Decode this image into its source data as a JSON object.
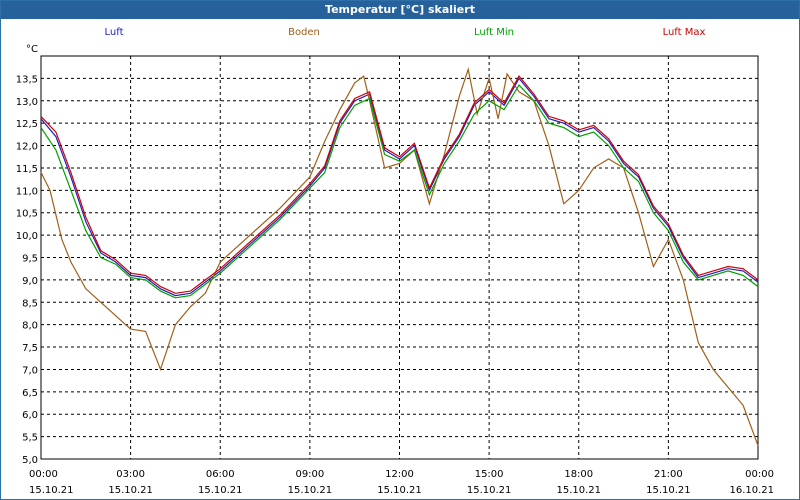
{
  "chart_data": {
    "type": "line",
    "title": "Temperatur [°C] skaliert",
    "ylabel": "°C",
    "xlabel": "",
    "ylim": [
      5.0,
      14.0
    ],
    "xlim": [
      0,
      24
    ],
    "y_ticks": [
      "5,0",
      "5,5",
      "6,0",
      "6,5",
      "7,0",
      "7,5",
      "8,0",
      "8,5",
      "9,0",
      "9,5",
      "10,0",
      "10,5",
      "11,0",
      "11,5",
      "12,0",
      "12,5",
      "13,0",
      "13,5"
    ],
    "x_ticks": [
      {
        "time": "00:00",
        "date": "15.10.21"
      },
      {
        "time": "03:00",
        "date": "15.10.21"
      },
      {
        "time": "06:00",
        "date": "15.10.21"
      },
      {
        "time": "09:00",
        "date": "15.10.21"
      },
      {
        "time": "12:00",
        "date": "15.10.21"
      },
      {
        "time": "15:00",
        "date": "15.10.21"
      },
      {
        "time": "18:00",
        "date": "15.10.21"
      },
      {
        "time": "21:00",
        "date": "15.10.21"
      },
      {
        "time": "00:00",
        "date": "16.10.21"
      }
    ],
    "grid": true,
    "legend_position": "top",
    "series": [
      {
        "name": "Luft",
        "color": "#2020c0",
        "points": [
          [
            0,
            12.6
          ],
          [
            0.5,
            12.2
          ],
          [
            1,
            11.3
          ],
          [
            1.5,
            10.3
          ],
          [
            2,
            9.6
          ],
          [
            2.5,
            9.4
          ],
          [
            3,
            9.1
          ],
          [
            3.5,
            9.05
          ],
          [
            4,
            8.8
          ],
          [
            4.5,
            8.65
          ],
          [
            5,
            8.7
          ],
          [
            5.5,
            8.95
          ],
          [
            6,
            9.2
          ],
          [
            7,
            9.8
          ],
          [
            8,
            10.4
          ],
          [
            9,
            11.1
          ],
          [
            9.5,
            11.5
          ],
          [
            10,
            12.5
          ],
          [
            10.5,
            13.0
          ],
          [
            11,
            13.15
          ],
          [
            11.5,
            11.9
          ],
          [
            12,
            11.7
          ],
          [
            12.5,
            12.0
          ],
          [
            13,
            11.0
          ],
          [
            13.5,
            11.7
          ],
          [
            14,
            12.2
          ],
          [
            14.5,
            12.9
          ],
          [
            15,
            13.2
          ],
          [
            15.5,
            12.9
          ],
          [
            16,
            13.5
          ],
          [
            16.5,
            13.1
          ],
          [
            17,
            12.6
          ],
          [
            17.5,
            12.5
          ],
          [
            18,
            12.3
          ],
          [
            18.5,
            12.4
          ],
          [
            19,
            12.1
          ],
          [
            19.5,
            11.6
          ],
          [
            20,
            11.3
          ],
          [
            20.5,
            10.6
          ],
          [
            21,
            10.2
          ],
          [
            21.5,
            9.5
          ],
          [
            22,
            9.05
          ],
          [
            22.5,
            9.15
          ],
          [
            23,
            9.25
          ],
          [
            23.5,
            9.2
          ],
          [
            24,
            8.95
          ]
        ]
      },
      {
        "name": "Boden",
        "color": "#a0601a",
        "points": [
          [
            0,
            11.4
          ],
          [
            0.3,
            11.0
          ],
          [
            0.7,
            9.9
          ],
          [
            1,
            9.4
          ],
          [
            1.5,
            8.8
          ],
          [
            2,
            8.5
          ],
          [
            2.5,
            8.2
          ],
          [
            3,
            7.9
          ],
          [
            3.5,
            7.85
          ],
          [
            4,
            7.0
          ],
          [
            4.5,
            8.0
          ],
          [
            5,
            8.4
          ],
          [
            5.5,
            8.7
          ],
          [
            6,
            9.4
          ],
          [
            7,
            10.0
          ],
          [
            8,
            10.6
          ],
          [
            9,
            11.3
          ],
          [
            9.5,
            12.1
          ],
          [
            10,
            12.8
          ],
          [
            10.5,
            13.4
          ],
          [
            10.8,
            13.55
          ],
          [
            11,
            13.0
          ],
          [
            11.5,
            11.5
          ],
          [
            12,
            11.6
          ],
          [
            12.5,
            11.9
          ],
          [
            13,
            10.7
          ],
          [
            13.5,
            11.8
          ],
          [
            14,
            13.1
          ],
          [
            14.3,
            13.7
          ],
          [
            14.6,
            12.7
          ],
          [
            15,
            13.5
          ],
          [
            15.3,
            12.6
          ],
          [
            15.6,
            13.6
          ],
          [
            16,
            13.2
          ],
          [
            16.5,
            13.0
          ],
          [
            17,
            12.0
          ],
          [
            17.5,
            10.7
          ],
          [
            18,
            11.0
          ],
          [
            18.5,
            11.5
          ],
          [
            19,
            11.7
          ],
          [
            19.5,
            11.5
          ],
          [
            20,
            10.5
          ],
          [
            20.5,
            9.3
          ],
          [
            21,
            9.9
          ],
          [
            21.5,
            9.0
          ],
          [
            22,
            7.6
          ],
          [
            22.5,
            7.0
          ],
          [
            23,
            6.6
          ],
          [
            23.5,
            6.2
          ],
          [
            24,
            5.3
          ]
        ]
      },
      {
        "name": "Luft Min",
        "color": "#00a000",
        "points": [
          [
            0,
            12.4
          ],
          [
            0.5,
            11.9
          ],
          [
            1,
            11.0
          ],
          [
            1.5,
            10.1
          ],
          [
            2,
            9.5
          ],
          [
            2.5,
            9.35
          ],
          [
            3,
            9.05
          ],
          [
            3.5,
            9.0
          ],
          [
            4,
            8.75
          ],
          [
            4.5,
            8.6
          ],
          [
            5,
            8.65
          ],
          [
            5.5,
            8.9
          ],
          [
            6,
            9.15
          ],
          [
            7,
            9.75
          ],
          [
            8,
            10.35
          ],
          [
            9,
            11.05
          ],
          [
            9.5,
            11.4
          ],
          [
            10,
            12.4
          ],
          [
            10.5,
            12.9
          ],
          [
            11,
            13.05
          ],
          [
            11.5,
            11.8
          ],
          [
            12,
            11.65
          ],
          [
            12.5,
            11.9
          ],
          [
            13,
            10.9
          ],
          [
            13.5,
            11.6
          ],
          [
            14,
            12.1
          ],
          [
            14.5,
            12.7
          ],
          [
            15,
            13.0
          ],
          [
            15.5,
            12.8
          ],
          [
            16,
            13.35
          ],
          [
            16.5,
            13.0
          ],
          [
            17,
            12.5
          ],
          [
            17.5,
            12.4
          ],
          [
            18,
            12.2
          ],
          [
            18.5,
            12.3
          ],
          [
            19,
            12.0
          ],
          [
            19.5,
            11.5
          ],
          [
            20,
            11.2
          ],
          [
            20.5,
            10.5
          ],
          [
            21,
            10.1
          ],
          [
            21.5,
            9.4
          ],
          [
            22,
            9.0
          ],
          [
            22.5,
            9.1
          ],
          [
            23,
            9.2
          ],
          [
            23.5,
            9.1
          ],
          [
            24,
            8.85
          ]
        ]
      },
      {
        "name": "Luft Max",
        "color": "#d00000",
        "points": [
          [
            0,
            12.65
          ],
          [
            0.5,
            12.3
          ],
          [
            1,
            11.4
          ],
          [
            1.5,
            10.4
          ],
          [
            2,
            9.65
          ],
          [
            2.5,
            9.45
          ],
          [
            3,
            9.15
          ],
          [
            3.5,
            9.1
          ],
          [
            4,
            8.85
          ],
          [
            4.5,
            8.7
          ],
          [
            5,
            8.75
          ],
          [
            5.5,
            9.0
          ],
          [
            6,
            9.25
          ],
          [
            7,
            9.85
          ],
          [
            8,
            10.45
          ],
          [
            9,
            11.15
          ],
          [
            9.5,
            11.55
          ],
          [
            10,
            12.55
          ],
          [
            10.5,
            13.05
          ],
          [
            11,
            13.2
          ],
          [
            11.5,
            11.95
          ],
          [
            12,
            11.75
          ],
          [
            12.5,
            12.05
          ],
          [
            13,
            11.05
          ],
          [
            13.5,
            11.75
          ],
          [
            14,
            12.25
          ],
          [
            14.5,
            12.95
          ],
          [
            15,
            13.25
          ],
          [
            15.5,
            12.95
          ],
          [
            16,
            13.55
          ],
          [
            16.5,
            13.15
          ],
          [
            17,
            12.65
          ],
          [
            17.5,
            12.55
          ],
          [
            18,
            12.35
          ],
          [
            18.5,
            12.45
          ],
          [
            19,
            12.15
          ],
          [
            19.5,
            11.65
          ],
          [
            20,
            11.35
          ],
          [
            20.5,
            10.65
          ],
          [
            21,
            10.25
          ],
          [
            21.5,
            9.55
          ],
          [
            22,
            9.1
          ],
          [
            22.5,
            9.2
          ],
          [
            23,
            9.3
          ],
          [
            23.5,
            9.25
          ],
          [
            24,
            9.0
          ]
        ]
      }
    ]
  }
}
